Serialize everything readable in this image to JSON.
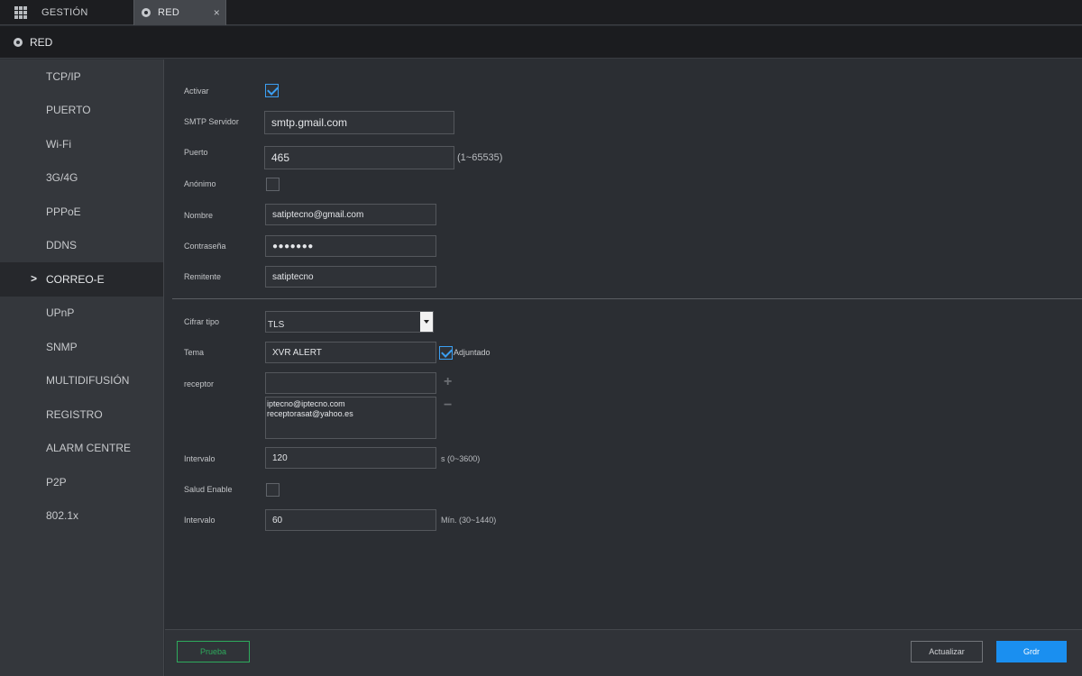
{
  "tabs": {
    "home_label": "GESTIÓN",
    "active_label": "RED",
    "close_glyph": "×"
  },
  "page": {
    "title": "RED"
  },
  "sidebar": {
    "items": [
      {
        "label": "TCP/IP"
      },
      {
        "label": "PUERTO"
      },
      {
        "label": "Wi-Fi"
      },
      {
        "label": "3G/4G"
      },
      {
        "label": "PPPoE"
      },
      {
        "label": "DDNS"
      },
      {
        "label": "CORREO-E",
        "active": true
      },
      {
        "label": "UPnP"
      },
      {
        "label": "SNMP"
      },
      {
        "label": "MULTIDIFUSIÓN"
      },
      {
        "label": "REGISTRO"
      },
      {
        "label": "ALARM CENTRE"
      },
      {
        "label": "P2P"
      },
      {
        "label": "802.1x"
      }
    ],
    "active_chevron": ">"
  },
  "form": {
    "enable": {
      "label": "Activar",
      "checked": true
    },
    "smtp_server": {
      "label": "SMTP Servidor",
      "value": "smtp.gmail.com"
    },
    "port": {
      "label": "Puerto",
      "value": "465",
      "range": "(1~65535)"
    },
    "anonymous": {
      "label": "Anónimo",
      "checked": false
    },
    "username": {
      "label": "Nombre",
      "value": "satiptecno@gmail.com"
    },
    "password": {
      "label": "Contraseña",
      "value": "●●●●●●●"
    },
    "sender": {
      "label": "Remitente",
      "value": "satiptecno"
    },
    "encryption": {
      "label": "Cifrar tipo",
      "value": "TLS"
    },
    "subject": {
      "label": "Tema",
      "value": "XVR ALERT"
    },
    "attachment": {
      "label": "Adjuntado",
      "checked": true
    },
    "receiver": {
      "label": "receptor",
      "input_value": "",
      "list": [
        "iptecno@iptecno.com",
        "receptorasat@yahoo.es"
      ],
      "add_glyph": "+",
      "remove_glyph": "−"
    },
    "interval": {
      "label": "Intervalo",
      "value": "120",
      "unit": "s (0~3600)"
    },
    "health_enable": {
      "label": "Salud Enable",
      "checked": false
    },
    "health_interval": {
      "label": "Intervalo",
      "value": "60",
      "unit": "Mín. (30~1440)"
    }
  },
  "buttons": {
    "test": "Prueba",
    "refresh": "Actualizar",
    "save": "Grdr"
  },
  "colors": {
    "accent": "#1a8ff0",
    "test_green": "#2eaa5c",
    "background": "#2b2e33",
    "sidebar": "#34373c"
  }
}
